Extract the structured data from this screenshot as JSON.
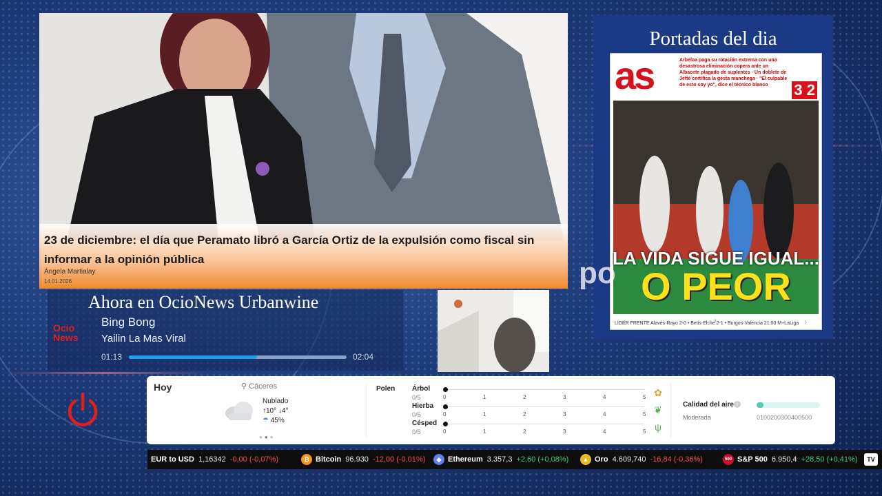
{
  "news": {
    "headline": "23 de diciembre: el día que Peramato libró a García Ortiz de la expulsión como fiscal sin informar a la opinión pública",
    "author": "Ángela Martialay",
    "date": "14.01.2026"
  },
  "portadas": {
    "title": "Portadas del dia",
    "cover": {
      "logo": "as",
      "score": "3 2",
      "top_text": "Arbeloa paga su rotación extrema con una desastrosa eliminación copera ante un Albacete plagado de suplentes · Un doblete de Jefté certifica la gesta manchega · \"El culpable de esto soy yo\", dice el técnico blanco",
      "headline_line1": "LA VIDA SIGUE IGUAL...",
      "headline_line2": "O PEOR",
      "footer": "LÍDER FRENTE  Alavés-Rayo 2-0 • Betis-Elche 2-1 • Burgos-Valencia 21:00 M+LaLiga"
    }
  },
  "now_playing": {
    "heading": "Ahora en OcioNews Urbanwine",
    "song": "Bing Bong",
    "artist": "Yailin La Mas Viral",
    "elapsed": "01:13",
    "duration": "02:04",
    "progress": 0.59,
    "logo_line1": "Ocio",
    "logo_line2": "News"
  },
  "ghost_text": "po",
  "weather": {
    "day_label": "Hoy",
    "location": "Cáceres",
    "condition": "Nublado",
    "temp_high": "10°",
    "temp_low": "4°",
    "rain_chance": "45%",
    "pollen_label": "Polen",
    "pollen": [
      {
        "name": "Árbol",
        "value": "0/5",
        "icon": "tree-icon"
      },
      {
        "name": "Hierba",
        "value": "0/5",
        "icon": "herb-icon"
      },
      {
        "name": "Césped",
        "value": "0/5",
        "icon": "grass-icon"
      }
    ],
    "scale": [
      "0",
      "1",
      "2",
      "3",
      "4",
      "5"
    ],
    "air_quality_label": "Calidad del aire",
    "air_quality_status": "Moderada",
    "air_quality_scale": "0100200300400500",
    "air_quality_level": 0.1
  },
  "ticker": [
    {
      "name": "EUR to USD",
      "price": "1,16342",
      "change": "-0,00 (-0,07%)",
      "dir": "neg",
      "icon": "",
      "color": ""
    },
    {
      "name": "Bitcoin",
      "price": "96.930",
      "change": "-12,00 (-0,01%)",
      "dir": "neg",
      "icon": "₿",
      "color": "#f7931a"
    },
    {
      "name": "Ethereum",
      "price": "3.357,3",
      "change": "+2,60 (+0,08%)",
      "dir": "pos",
      "icon": "◆",
      "color": "#627eea"
    },
    {
      "name": "Oro",
      "price": "4.609,740",
      "change": "-16,84 (-0,36%)",
      "dir": "neg",
      "icon": "▲",
      "color": "#e8b923"
    },
    {
      "name": "S&P 500",
      "price": "6.950,4",
      "change": "+28,50 (+0,41%)",
      "dir": "pos",
      "icon": "500",
      "color": "#c8102e"
    }
  ],
  "ticker_logo": "TV",
  "colors": {
    "accent": "#1ea0f0",
    "brand_red": "#d8101b",
    "panel_blue": "#1b3a85"
  }
}
